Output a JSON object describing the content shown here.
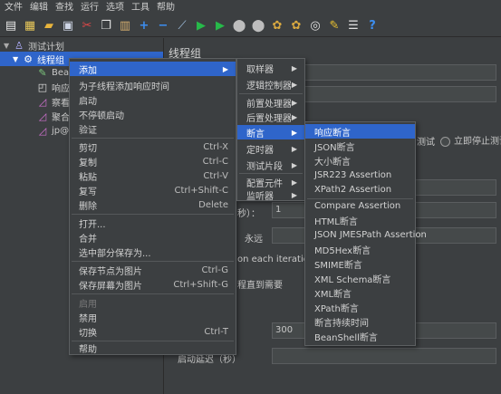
{
  "menubar": [
    "文件",
    "编辑",
    "查找",
    "运行",
    "选项",
    "工具",
    "帮助"
  ],
  "toolbar_icons": [
    "new-icon",
    "template-icon",
    "open-icon",
    "save-icon",
    "cut-icon",
    "copy-icon",
    "paste-icon",
    "expand-icon",
    "collapse-icon",
    "toggle-icon",
    "start-icon",
    "start-no-pause-icon",
    "stop-icon",
    "shutdown-icon",
    "clear-icon",
    "clear-all-icon",
    "search-icon",
    "reset-search-icon",
    "function-helper-icon",
    "help-icon"
  ],
  "tree": {
    "root": "测试计划",
    "thread_group": "线程组",
    "children": [
      "Bea",
      "响应",
      "察看",
      "聚合",
      "jp@"
    ]
  },
  "panel": {
    "title": "线程组",
    "action_radio": "测试",
    "stop_test_now": "立即停止测试",
    "seconds_label": "秒）：",
    "ramp_value": "1",
    "forever": "永远",
    "same_user": "on each iteration",
    "delay_creation": "程直到需要",
    "duration_value": "300",
    "startup_delay": "启动延迟（秒）"
  },
  "context_menu": {
    "items": [
      {
        "label": "添加",
        "shortcut": "",
        "submenu": true,
        "highlighted": true
      },
      {
        "label": "为子线程添加响应时间",
        "shortcut": ""
      },
      {
        "label": "启动",
        "shortcut": ""
      },
      {
        "label": "不停顿启动",
        "shortcut": ""
      },
      {
        "label": "验证",
        "shortcut": ""
      },
      {
        "label": "剪切",
        "shortcut": "Ctrl-X"
      },
      {
        "label": "复制",
        "shortcut": "Ctrl-C"
      },
      {
        "label": "粘贴",
        "shortcut": "Ctrl-V"
      },
      {
        "label": "复写",
        "shortcut": "Ctrl+Shift-C"
      },
      {
        "label": "删除",
        "shortcut": "Delete"
      },
      {
        "label": "打开...",
        "shortcut": ""
      },
      {
        "label": "合并",
        "shortcut": ""
      },
      {
        "label": "选中部分保存为...",
        "shortcut": ""
      },
      {
        "label": "保存节点为图片",
        "shortcut": "Ctrl-G"
      },
      {
        "label": "保存屏幕为图片",
        "shortcut": "Ctrl+Shift-G"
      },
      {
        "label": "启用",
        "shortcut": "",
        "disabled": true
      },
      {
        "label": "禁用",
        "shortcut": ""
      },
      {
        "label": "切换",
        "shortcut": "Ctrl-T"
      },
      {
        "label": "帮助",
        "shortcut": ""
      }
    ]
  },
  "add_submenu": {
    "items": [
      {
        "label": "取样器"
      },
      {
        "label": "逻辑控制器"
      },
      {
        "label": "前置处理器"
      },
      {
        "label": "后置处理器"
      },
      {
        "label": "断言",
        "highlighted": true
      },
      {
        "label": "定时器"
      },
      {
        "label": "测试片段"
      },
      {
        "label": "配置元件"
      },
      {
        "label": "监听器"
      }
    ]
  },
  "assertion_submenu": {
    "items": [
      "响应断言",
      "JSON断言",
      "大小断言",
      "JSR223 Assertion",
      "XPath2 Assertion",
      "Compare Assertion",
      "HTML断言",
      "JSON JMESPath Assertion",
      "MD5Hex断言",
      "SMIME断言",
      "XML Schema断言",
      "XML断言",
      "XPath断言",
      "断言持续时间",
      "BeanShell断言"
    ]
  },
  "colors": {
    "background": "#3c3f41",
    "highlight": "#2f65ca",
    "text": "#d2d2d2"
  }
}
